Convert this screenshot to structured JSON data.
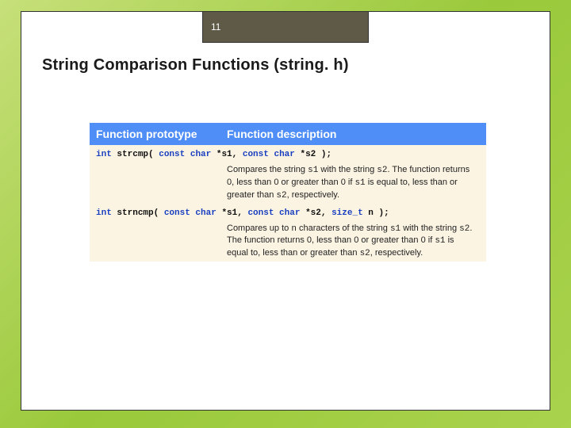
{
  "slide": {
    "number": "11",
    "heading": "String Comparison Functions (string. h)",
    "table": {
      "header": {
        "col1": "Function prototype",
        "col2": "Function description"
      },
      "rows": [
        {
          "proto_plain": "int strcmp( const char *s1, const char *s2 );",
          "proto_segments": [
            {
              "t": "kw",
              "v": "int"
            },
            {
              "t": "tx",
              "v": " strcmp( "
            },
            {
              "t": "kw",
              "v": "const char"
            },
            {
              "t": "tx",
              "v": " *s1, "
            },
            {
              "t": "kw",
              "v": "const char"
            },
            {
              "t": "tx",
              "v": " *s2 );"
            }
          ],
          "desc_segments": [
            {
              "t": "tx",
              "v": "Compares the string "
            },
            {
              "t": "code",
              "v": "s1"
            },
            {
              "t": "tx",
              "v": " with the string "
            },
            {
              "t": "code",
              "v": "s2"
            },
            {
              "t": "tx",
              "v": ". The function returns 0, less than 0 or greater than 0 if "
            },
            {
              "t": "code",
              "v": "s1"
            },
            {
              "t": "tx",
              "v": " is equal to, less than or greater than "
            },
            {
              "t": "code",
              "v": "s2"
            },
            {
              "t": "tx",
              "v": ", respectively."
            }
          ]
        },
        {
          "proto_plain": "int strncmp( const char *s1, const char *s2, size_t n );",
          "proto_segments": [
            {
              "t": "kw",
              "v": "int"
            },
            {
              "t": "tx",
              "v": " strncmp( "
            },
            {
              "t": "kw",
              "v": "const char"
            },
            {
              "t": "tx",
              "v": " *s1, "
            },
            {
              "t": "kw",
              "v": "const char"
            },
            {
              "t": "tx",
              "v": " *s2, "
            },
            {
              "t": "kw",
              "v": "size_t"
            },
            {
              "t": "tx",
              "v": " n );"
            }
          ],
          "desc_segments": [
            {
              "t": "tx",
              "v": "Compares up to "
            },
            {
              "t": "code",
              "v": "n"
            },
            {
              "t": "tx",
              "v": " characters of the string "
            },
            {
              "t": "code",
              "v": "s1"
            },
            {
              "t": "tx",
              "v": " with the string "
            },
            {
              "t": "code",
              "v": "s2"
            },
            {
              "t": "tx",
              "v": ". The function returns 0, less than 0 or greater than 0 if "
            },
            {
              "t": "code",
              "v": "s1"
            },
            {
              "t": "tx",
              "v": " is equal to, less than or greater than "
            },
            {
              "t": "code",
              "v": "s2"
            },
            {
              "t": "tx",
              "v": ", respectively."
            }
          ]
        }
      ]
    }
  }
}
